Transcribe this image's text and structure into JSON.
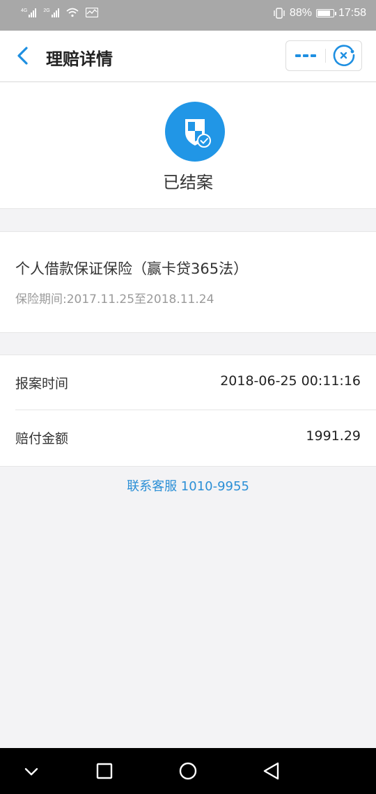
{
  "status_bar": {
    "net1": "4G",
    "net2": "2G",
    "battery_percent": "88%",
    "battery_level": 0.88,
    "time": "17:58"
  },
  "nav": {
    "title": "理赔详情",
    "icons": {
      "back": "chevron-left-icon",
      "more": "more-dots-icon",
      "close": "close-circle-icon"
    }
  },
  "status": {
    "text": "已结案",
    "icon": "shield-check-icon",
    "icon_color": "#2196e6"
  },
  "policy": {
    "name": "个人借款保证保险（赢卡贷365法）",
    "period": "保险期间:2017.11.25至2018.11.24"
  },
  "details": [
    {
      "label": "报案时间",
      "value": "2018-06-25 00:11:16"
    },
    {
      "label": "赔付金额",
      "value": "1991.29"
    }
  ],
  "contact": {
    "text": "联系客服 1010-9955",
    "color": "#2b8fd6"
  },
  "system_nav": {
    "icons": [
      "chevron-down-icon",
      "square-icon",
      "circle-icon",
      "triangle-back-icon"
    ]
  },
  "colors": {
    "accent": "#2196e6",
    "background": "#f3f3f5"
  }
}
